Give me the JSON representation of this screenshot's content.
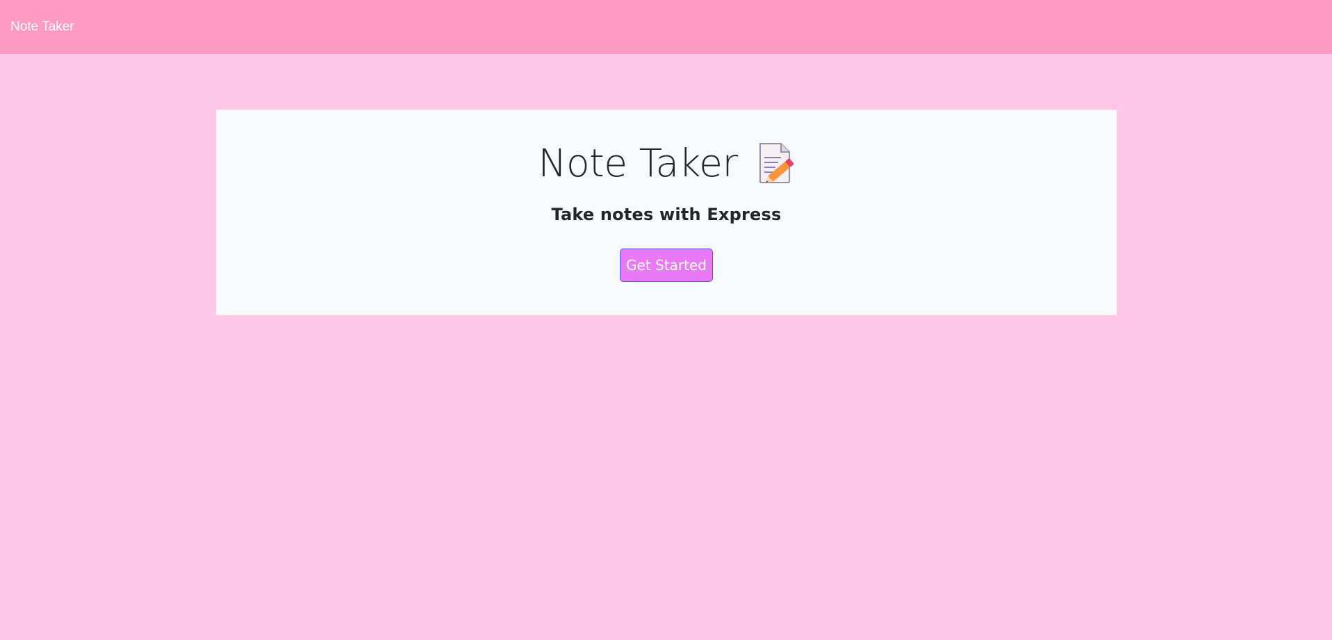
{
  "navbar": {
    "brand": "Note Taker"
  },
  "hero": {
    "title": "Note Taker",
    "title_icon": "memo-icon",
    "subtitle": "Take notes with Express",
    "cta_label": "Get Started"
  },
  "colors": {
    "page_background": "#ffc8e6",
    "navbar_background": "#ff9bc0",
    "card_background": "#f8f9fa",
    "button_background": "#e87af5",
    "button_border": "#5b5bd6"
  }
}
